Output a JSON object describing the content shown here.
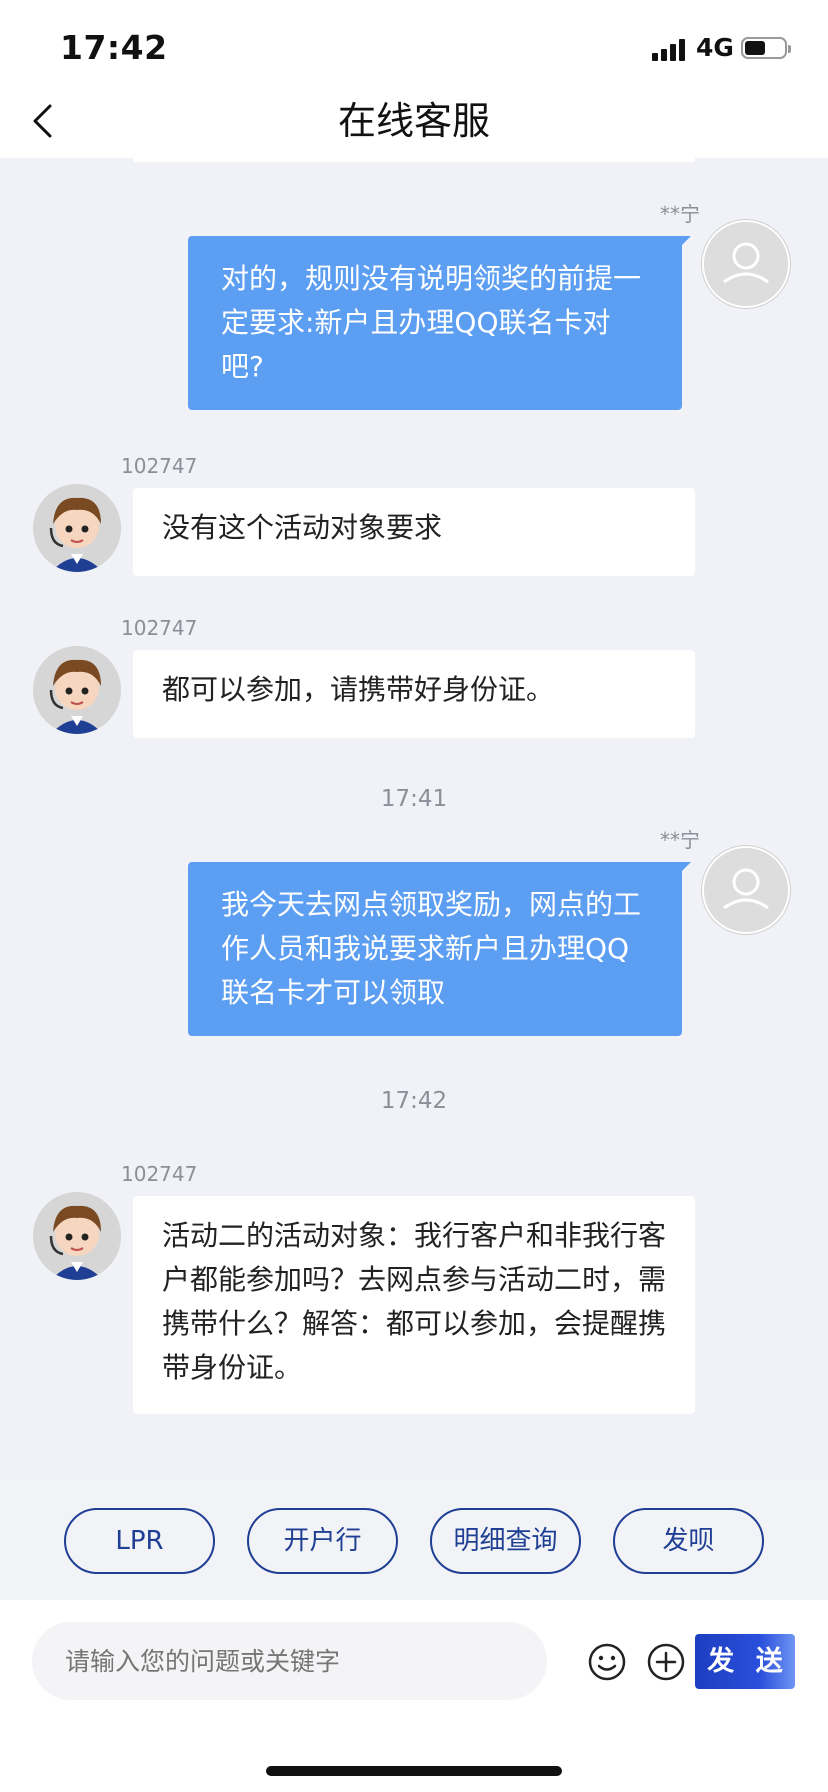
{
  "status_bar": {
    "time": "17:42",
    "network": "4G"
  },
  "header": {
    "title": "在线客服"
  },
  "messages": [
    {
      "sender": "**宁",
      "text": "对的，规则没有说明领奖的前提一定要求:新户且办理QQ联名卡对吧?"
    },
    {
      "sender": "102747",
      "text": "没有这个活动对象要求"
    },
    {
      "sender": "102747",
      "text": "都可以参加，请携带好身份证。"
    },
    {
      "timestamp": "17:41"
    },
    {
      "sender": "**宁",
      "text": "我今天去网点领取奖励，网点的工作人员和我说要求新户且办理QQ联名卡才可以领取"
    },
    {
      "timestamp": "17:42"
    },
    {
      "sender": "102747",
      "text": "活动二的活动对象：我行客户和非我行客户都能参加吗？去网点参与活动二时，需携带什么？解答：都可以参加，会提醒携带身份证。"
    }
  ],
  "quick_actions": [
    "LPR",
    "开户行",
    "明细查询",
    "发呗"
  ],
  "input": {
    "placeholder": "请输入您的问题或关键字",
    "send_label": "发 送"
  },
  "icons": {
    "back": "chevron-left-icon",
    "emoji": "smiley-icon",
    "add": "plus-circle-icon",
    "user_avatar": "user-silhouette-icon",
    "agent_avatar": "agent-avatar-icon"
  },
  "colors": {
    "user_bubble": "#5c9ef2",
    "agent_bubble": "#ffffff",
    "chip_border": "#1f3f94",
    "send_button": "#2a4fdb"
  }
}
